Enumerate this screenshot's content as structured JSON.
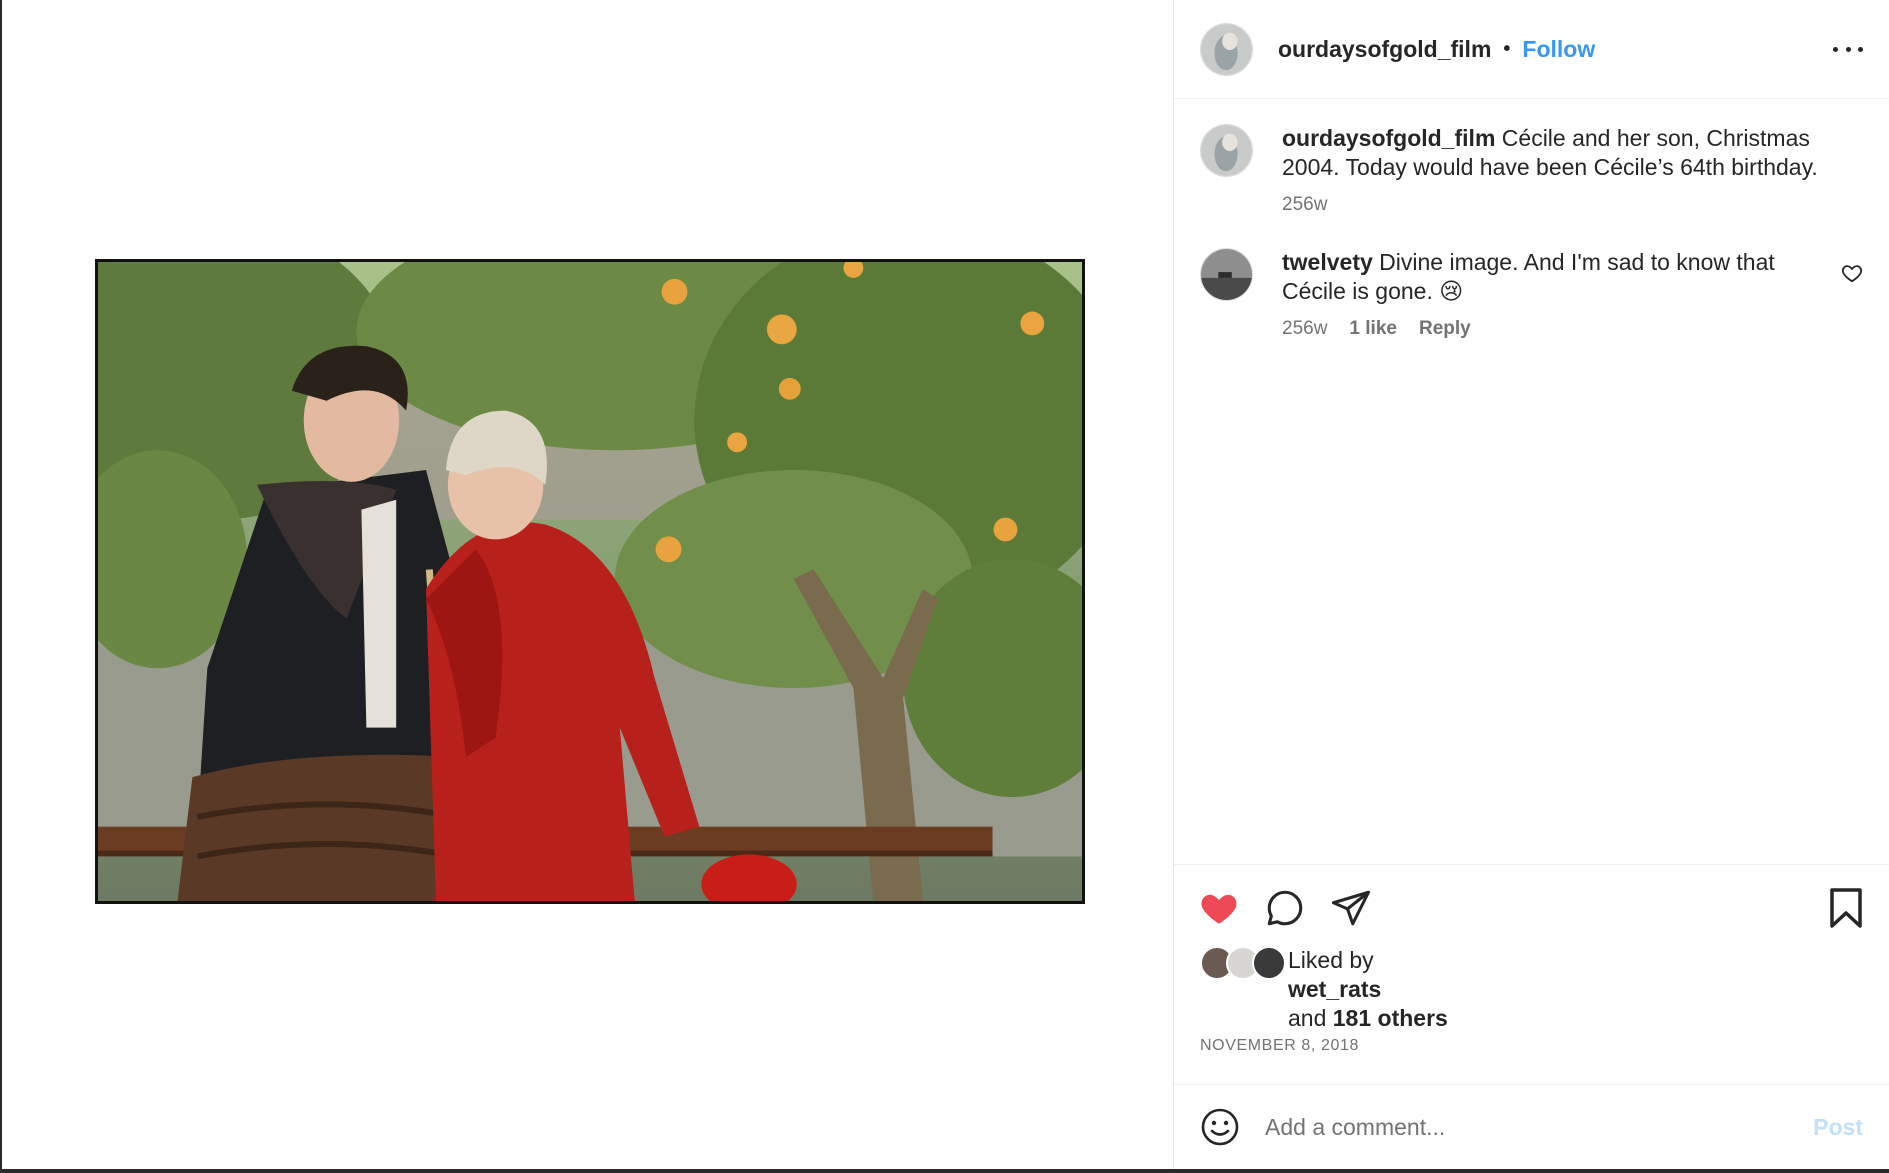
{
  "post": {
    "author": "ourdaysofgold_film",
    "follow_label": "Follow",
    "separator": "•",
    "more_icon": "ellipsis-icon",
    "image_alt": "Photo of a young man in a dark coat and a woman in a red sweater beneath an orange tree"
  },
  "caption": {
    "username": "ourdaysofgold_film",
    "text": " Cécile and her son, Christmas 2004. Today would have been Cécile’s 64th birthday.",
    "age": "256w"
  },
  "comments": [
    {
      "username": "twelvety",
      "text": " Divine image. And I'm sad to know that Cécile is gone. 😢",
      "age": "256w",
      "likes": "1 like",
      "reply_label": "Reply"
    }
  ],
  "actions": {
    "like_icon": "heart-filled-icon",
    "comment_icon": "comment-icon",
    "share_icon": "paper-plane-icon",
    "save_icon": "bookmark-icon",
    "like_color": "#ed4956"
  },
  "likes": {
    "prefix": "Liked by",
    "user": "wet_rats",
    "and": "and ",
    "others": "181 others"
  },
  "date": "NOVEMBER 8, 2018",
  "composer": {
    "placeholder": "Add a comment...",
    "post_label": "Post",
    "emoji_icon": "smiley-icon"
  },
  "colors": {
    "link": "#3897f0",
    "muted": "#737373",
    "post_disabled": "#c3dffa"
  }
}
